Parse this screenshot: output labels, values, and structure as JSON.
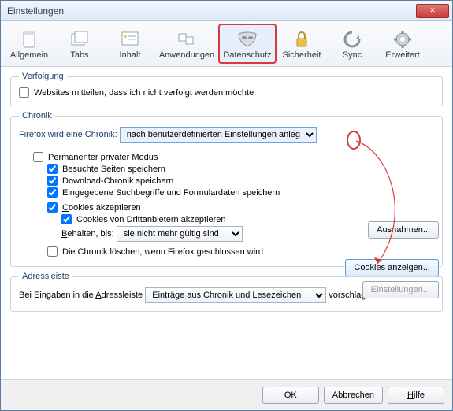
{
  "window": {
    "title": "Einstellungen"
  },
  "toolbar": {
    "items": [
      {
        "label": "Allgemein"
      },
      {
        "label": "Tabs"
      },
      {
        "label": "Inhalt"
      },
      {
        "label": "Anwendungen"
      },
      {
        "label": "Datenschutz"
      },
      {
        "label": "Sicherheit"
      },
      {
        "label": "Sync"
      },
      {
        "label": "Erweitert"
      }
    ]
  },
  "tracking": {
    "legend": "Verfolgung",
    "dnt": "Websites mitteilen, dass ich nicht verfolgt werden möchte"
  },
  "history": {
    "legend": "Chronik",
    "label_pre": "Firefox wird eine Chronik:",
    "mode": "nach benutzerdefinierten Einstellungen anlegen",
    "perm_private": "Permanenter privater Modus",
    "visited": "Besuchte Seiten speichern",
    "downloads": "Download-Chronik speichern",
    "formdata": "Eingegebene Suchbegriffe und Formulardaten speichern",
    "cookies": "Cookies akzeptieren",
    "thirdparty": "Cookies von Drittanbietern akzeptieren",
    "keep_label": "Behalten, bis:",
    "keep_value": "sie nicht mehr gültig sind",
    "clear_on_close": "Die Chronik löschen, wenn Firefox geschlossen wird",
    "btn_exceptions": "Ausnahmen...",
    "btn_show_cookies": "Cookies anzeigen...",
    "btn_settings": "Einstellungen..."
  },
  "addressbar": {
    "legend": "Adressleiste",
    "label_pre": "Bei Eingaben in die Adressleiste",
    "value": "Einträge aus Chronik und Lesezeichen",
    "label_post": "vorschlagen"
  },
  "footer": {
    "ok": "OK",
    "cancel": "Abbrechen",
    "help": "Hilfe"
  }
}
